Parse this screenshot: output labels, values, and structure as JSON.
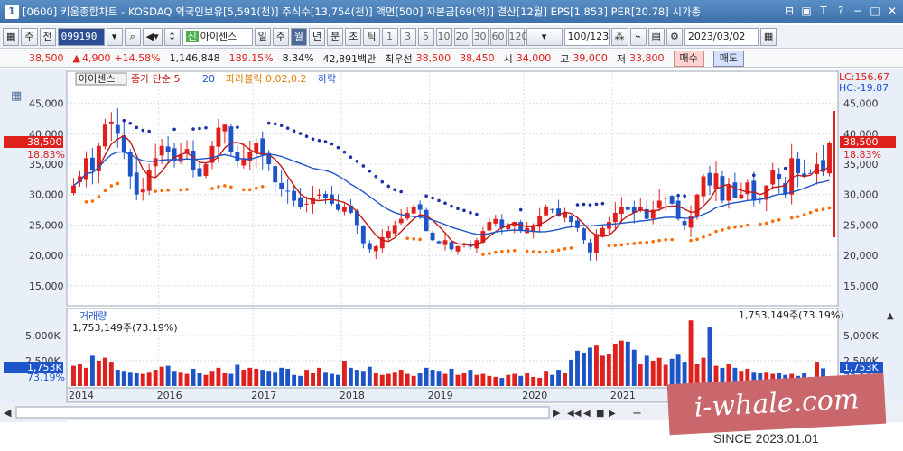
{
  "window": {
    "icon_label": "1",
    "title": "[0600] 키움종합차트 - KOSDAQ 외국인보유[5,591(천)] 주식수[13,754(천)] 액면[500] 자본금[69(억)] 결산[12월] EPS[1,853] PER[20.78] 시가총"
  },
  "toolbar": {
    "type": "주",
    "market": "전",
    "stock_code": "099190",
    "sin_badge": "신",
    "stock_name": "아이센스",
    "periods": [
      "일",
      "주",
      "월",
      "년",
      "분",
      "초",
      "틱"
    ],
    "active_period": "월",
    "nums": [
      "1",
      "3",
      "5",
      "10",
      "20",
      "30",
      "60",
      "120"
    ],
    "count": "100/123",
    "date": "2023/03/02"
  },
  "quote": {
    "price": "38,500",
    "change_arrow": "▲",
    "change": "4,900",
    "change_pct": "+14.58%",
    "volume": "1,146,848",
    "volume_pct": "189.15%",
    "turnover": "8.34%",
    "amount": "42,891백만",
    "best_label": "최우선",
    "ask": "38,500",
    "bid": "38,450",
    "open_label": "시",
    "open": "34,000",
    "high_label": "고",
    "high": "39,000",
    "low_label": "저",
    "low": "33,800",
    "buy_label": "매수",
    "sell_label": "매도"
  },
  "legend": {
    "stock": "아이센스",
    "ma": "종가 단순 5",
    "ma2": "20",
    "sar": "파라볼릭 0.02,0.2",
    "signal": "하락",
    "lc": "LC:156.67",
    "hc": "HC:-19.87",
    "price_tag": "38,500",
    "pct_tag": "18.83%",
    "left_price_tag": "38,500",
    "left_pct_tag": "18.83%"
  },
  "volume_panel": {
    "label": "거래량",
    "info": "1,753,149주(73.19%)",
    "info_right": "1,753,149주(73.19%)",
    "tag_right": "1,753K",
    "tag_right2": "73.19%",
    "tag_left": "1,753K",
    "tag_left2": "73.19%"
  },
  "watermark": {
    "text": "i-whale.com",
    "since": "SINCE 2023.01.01"
  },
  "chart_data": {
    "type": "candlestick",
    "y_ticks": [
      "45,000",
      "40,000",
      "35,000",
      "30,000",
      "25,000",
      "20,000",
      "15,000"
    ],
    "y_tick_values": [
      45000,
      40000,
      35000,
      30000,
      25000,
      20000,
      15000
    ],
    "ylim": [
      12000,
      50000
    ],
    "x_labels": [
      "2014",
      "2016",
      "2017",
      "2018",
      "2019",
      "2020",
      "2021"
    ],
    "vol_ticks": [
      "5,000K",
      "2,500K"
    ],
    "vol_tick_values": [
      5000000,
      2500000
    ],
    "vol_max": 7500000,
    "colors": {
      "up": "#e0201c",
      "down": "#1d55c9",
      "ma5": "#c21818",
      "ma20": "#1d55c9",
      "sar": "#ff6a00",
      "sar_down": "#1d2fa8"
    },
    "closes": [
      31500,
      33000,
      36000,
      34000,
      38000,
      41500,
      42000,
      40000,
      37000,
      33000,
      30000,
      31000,
      34000,
      36000,
      38000,
      37000,
      35500,
      36500,
      37500,
      34000,
      33000,
      35000,
      38000,
      41000,
      41500,
      37000,
      35500,
      36000,
      37000,
      38500,
      36500,
      35000,
      32000,
      31000,
      30500,
      29000,
      28000,
      28500,
      29500,
      30000,
      29500,
      28500,
      27500,
      28000,
      27000,
      25000,
      22000,
      21000,
      21500,
      23000,
      24000,
      25000,
      26000,
      27000,
      28000,
      27500,
      24000,
      22500,
      22000,
      22500,
      21000,
      21500,
      22000,
      21500,
      22500,
      24000,
      25500,
      26000,
      24500,
      25000,
      25500,
      24000,
      24500,
      25000,
      26500,
      28000,
      27500,
      26500,
      27000,
      25500,
      24500,
      22500,
      20500,
      23500,
      24500,
      25500,
      27000,
      28000,
      27500,
      27000,
      28000,
      26000,
      27500,
      29000,
      29500,
      28500,
      26000,
      25000,
      26500,
      30000,
      33000,
      31500,
      33500,
      29000,
      31500,
      29500,
      30000,
      32000,
      29000,
      29500,
      31500,
      34000,
      32500,
      30000,
      36000,
      33500,
      33000,
      33500,
      35000,
      33800,
      38500
    ],
    "vols": [
      2000000,
      2200000,
      1800000,
      3000000,
      2500000,
      2800000,
      2400000,
      1600000,
      1500000,
      1400000,
      1300000,
      1200000,
      1400000,
      1600000,
      1900000,
      2000000,
      1500000,
      1400000,
      1200000,
      1700000,
      1300000,
      1100000,
      1500000,
      1800000,
      1300000,
      1200000,
      2100000,
      1600000,
      1800000,
      1700000,
      1600000,
      1500000,
      1400000,
      1800000,
      1700000,
      1100000,
      1000000,
      1600000,
      1300000,
      1800000,
      1400000,
      1200000,
      1100000,
      2500000,
      1800000,
      1600000,
      1500000,
      1900000,
      1300000,
      1100000,
      1200000,
      1400000,
      1600000,
      1200000,
      1000000,
      1300000,
      1800000,
      1600000,
      1500000,
      1200000,
      1700000,
      1100000,
      1300000,
      1600000,
      1100000,
      1200000,
      1000000,
      900000,
      800000,
      1100000,
      1200000,
      1000000,
      1300000,
      900000,
      800000,
      1500000,
      1100000,
      1600000,
      1300000,
      2600000,
      3500000,
      3300000,
      3800000,
      4000000,
      3000000,
      3200000,
      4200000,
      4500000,
      4400000,
      3600000,
      2200000,
      3000000,
      2500000,
      2800000,
      2100000,
      2700000,
      3100000,
      2400000,
      6500000,
      2200000,
      2800000,
      5800000,
      2000000,
      1800000,
      2200000,
      1800000,
      1500000,
      1700000,
      1400000,
      1300000,
      1400000,
      1200000,
      1300000,
      1100000,
      1200000,
      1000000,
      1300000,
      900000,
      2400000,
      1753149
    ]
  }
}
